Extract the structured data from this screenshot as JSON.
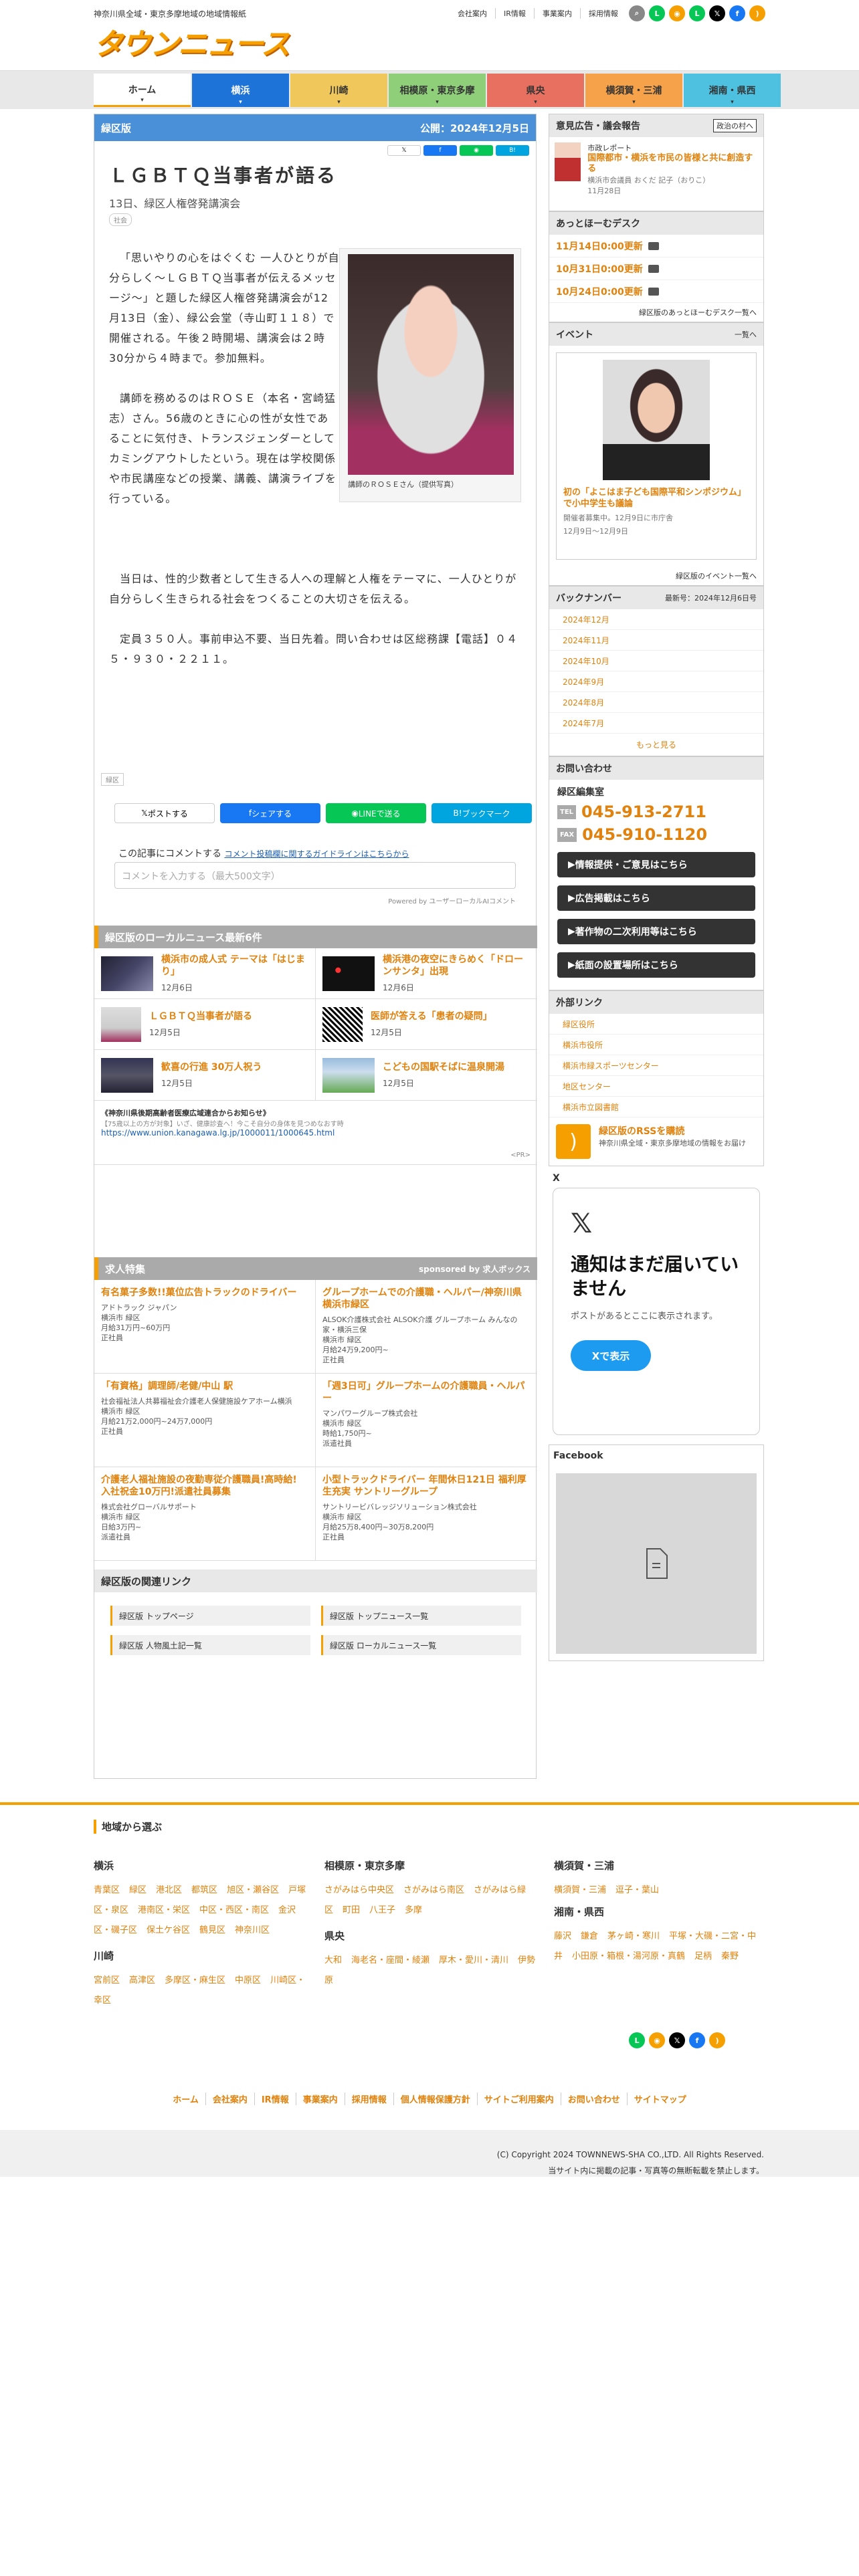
{
  "header": {
    "tagline": "神奈川県全域・東京多摩地域の地域情報紙",
    "logo": "タウンニュース",
    "toplinks": [
      "会社案内",
      "IR情報",
      "事業案内",
      "採用情報"
    ]
  },
  "nav": {
    "items": [
      {
        "label": "ホーム",
        "color": "#ffffff",
        "text": "#333333"
      },
      {
        "label": "横浜",
        "color": "#1e73d8",
        "text": "#ffffff"
      },
      {
        "label": "川崎",
        "color": "#f0c75a",
        "text": "#333333"
      },
      {
        "label": "相模原・東京多摩",
        "color": "#8fcf7a",
        "text": "#333333"
      },
      {
        "label": "県央",
        "color": "#e87060",
        "text": "#333333"
      },
      {
        "label": "横須賀・三浦",
        "color": "#f6a24a",
        "text": "#333333"
      },
      {
        "label": "湘南・県西",
        "color": "#4ec1e0",
        "text": "#333333"
      }
    ]
  },
  "article": {
    "edition": "緑区版",
    "published": "公開：2024年12月5日",
    "title": "ＬＧＢＴＱ当事者が語る",
    "subtitle": "13日、緑区人権啓発講演会",
    "tag": "社会",
    "p1": "「思いやりの心をはぐくむ 一人ひとりが自分らしく～ＬＧＢＴＱ当事者が伝えるメッセージ～」と題した緑区人権啓発講演会が12月13日（金）、緑公会堂（寺山町１１８）で開催される。午後２時開場、講演会は２時30分から４時まで。参加無料。",
    "p2": "講師を務めるのはＲＯＳＥ（本名・宮崎猛志）さん。56歳のときに心の性が女性であることに気付き、トランスジェンダーとしてカミングアウトしたという。現在は学校関係や市民講座などの授業、講義、講演ライブを行っている。",
    "p3": "当日は、性的少数者として生きる人への理解と人権をテーマに、一人ひとりが自分らしく生きられる社会をつくることの大切さを伝える。",
    "p4": "定員３５０人。事前申込不要、当日先着。問い合わせは区総務課【電話】０４５・９３０・２２１１。",
    "photo_caption": "講師のＲＯＳＥさん（提供写真）",
    "area_tag": "緑区",
    "share": {
      "x": "ポストする",
      "fb": "シェアする",
      "line": "LINEで送る",
      "hatena": "ブックマーク"
    },
    "comment_label": "この記事にコメントする",
    "comment_link": "コメント投稿欄に関するガイドラインはこちらから",
    "comment_placeholder": "コメントを入力する（最大500文字）",
    "powered": "Powered by ユーザーローカルAIコメント"
  },
  "local_news": {
    "heading": "緑区版のローカルニュース最新6件",
    "items": [
      {
        "title": "横浜市の成人式 テーマは「はじまり」",
        "date": "12月6日"
      },
      {
        "title": "横浜港の夜空にきらめく「ドローンサンタ」出現",
        "date": "12月6日"
      },
      {
        "title": "ＬＧＢＴＱ当事者が語る",
        "date": "12月5日"
      },
      {
        "title": "医師が答える「患者の疑問」",
        "date": "12月5日"
      },
      {
        "title": "歓喜の行進 30万人祝う",
        "date": "12月5日"
      },
      {
        "title": "こどもの国駅そばに温泉開湯",
        "date": "12月5日"
      }
    ],
    "pr_title": "《神奈川県後期高齢者医療広域連合からお知らせ》",
    "pr_sub": "【75歳以上の方が対象】いざ、健康診査へ！今こそ自分の身体を見つめなおす時",
    "pr_url": "https://www.union.kanagawa.lg.jp/1000011/1000645.html",
    "pr_badge": "<PR>"
  },
  "jobs": {
    "heading": "求人特集",
    "sponsor": "sponsored by 求人ボックス",
    "items": [
      {
        "title": "有名菓子多数!!菓位広告トラックのドライバー",
        "company": "アドトラック ジャパン",
        "area": "横浜市 緑区",
        "pay": "月給31万円~60万円",
        "type": "正社員"
      },
      {
        "title": "グループホームでの介護職・ヘルパー/神奈川県横浜市緑区",
        "company": "ALSOK介護株式会社 ALSOK介護 グループホーム みんなの家・横浜三保",
        "area": "横浜市 緑区",
        "pay": "月給24万9,200円~",
        "type": "正社員"
      },
      {
        "title": "「有資格」調理師/老健/中山 駅",
        "company": "社会福祉法人共募福祉会介護老人保健施設ケアホーム横浜",
        "area": "横浜市 緑区",
        "pay": "月給21万2,000円~24万7,000円",
        "type": "正社員"
      },
      {
        "title": "「週3日可」グループホームの介護職員・ヘルパー",
        "company": "マンパワーグループ株式会社",
        "area": "横浜市 緑区",
        "pay": "時給1,750円~",
        "type": "派遣社員"
      },
      {
        "title": "介護老人福祉施設の夜勤専従介護職員!高時給! 入社祝金10万円!派遣社員募集",
        "company": "株式会社グローバルサポート",
        "area": "横浜市 緑区",
        "pay": "日給3万円~",
        "type": "派遣社員"
      },
      {
        "title": "小型トラックドライバー 年間休日121日 福利厚生充実 サントリーグループ",
        "company": "サントリービバレッジソリューション株式会社",
        "area": "横浜市 緑区",
        "pay": "月給25万8,400円~30万8,200円",
        "type": "正社員"
      }
    ]
  },
  "related": {
    "heading": "緑区版の関連リンク",
    "items": [
      "緑区版 トップページ",
      "緑区版 トップニュース一覧",
      "緑区版 人物風土記一覧",
      "緑区版 ローカルニュース一覧"
    ]
  },
  "sidebar": {
    "opinion_head": "意見広告・議会報告",
    "opinion_badge": "政治の村へ",
    "opinion_cat": "市政レポート",
    "opinion_title": "国際都市・横浜を市民の皆様と共に創造する",
    "opinion_author": "横浜市会議員 おくだ 記子（おりこ）",
    "opinion_date": "11月28日",
    "desk_head": "あっとほーむデスク",
    "desk_items": [
      "11月14日0:00更新",
      "10月31日0:00更新",
      "10月24日0:00更新"
    ],
    "desk_more": "緑区版のあっとほーむデスク一覧へ",
    "event_head": "イベント",
    "event_more": "一覧へ",
    "event_title": "初の「よこはま子ども国際平和シンポジウム」で小中学生も議論",
    "event_org": "開催者募集中。12月9日に市庁舎",
    "event_date": "12月9日～12月9日",
    "event_list": "緑区版のイベント一覧へ",
    "back_head": "バックナンバー",
    "back_latest": "最新号：2024年12月6日号",
    "back_items": [
      "2024年12月",
      "2024年11月",
      "2024年10月",
      "2024年9月",
      "2024年8月",
      "2024年7月"
    ],
    "back_more": "もっと見る",
    "contact_head": "お問い合わせ",
    "contact_office": "緑区編集室",
    "tel_label": "TEL",
    "fax_label": "FAX",
    "tel": "045-913-2711",
    "fax": "045-910-1120",
    "contact_buttons": [
      "情報提供・ご意見はこちら",
      "広告掲載はこちら",
      "著作物の二次利用等はこちら",
      "紙面の設置場所はこちら"
    ],
    "ext_head": "外部リンク",
    "ext_items": [
      "緑区役所",
      "横浜市役所",
      "横浜市緑スポーツセンター",
      "地区センター",
      "横浜市立図書館"
    ],
    "rss_title": "緑区版のRSSを購読",
    "rss_desc": "神奈川県全域・東京多摩地域の情報をお届け",
    "x_head": "X",
    "x_title": "通知はまだ届いていません",
    "x_sub": "ポストがあるとここに表示されます。",
    "x_button": "Xで表示",
    "fb_head": "Facebook"
  },
  "footer": {
    "heading": "地域から選ぶ",
    "yokohama_head": "横浜",
    "yokohama_links": [
      "青葉区",
      "緑区",
      "港北区",
      "都筑区",
      "旭区・瀬谷区",
      "戸塚区・泉区",
      "港南区・栄区",
      "中区・西区・南区",
      "金沢区・磯子区",
      "保土ケ谷区",
      "鶴見区",
      "神奈川区"
    ],
    "kawasaki_head": "川崎",
    "kawasaki_links": [
      "宮前区",
      "高津区",
      "多摩区・麻生区",
      "中原区",
      "川崎区・幸区"
    ],
    "sagami_head": "相模原・東京多摩",
    "sagami_links": [
      "さがみはら中央区",
      "さがみはら南区",
      "さがみはら緑区",
      "町田",
      "八王子",
      "多摩"
    ],
    "kenou_head": "県央",
    "kenou_links": [
      "大和",
      "海老名・座間・綾瀬",
      "厚木・愛川・清川",
      "伊勢原"
    ],
    "yokosuka_head": "横須賀・三浦",
    "yokosuka_links": [
      "横須賀・三浦",
      "逗子・葉山"
    ],
    "shonan_head": "湘南・県西",
    "shonan_links": [
      "藤沢",
      "鎌倉",
      "茅ヶ崎・寒川",
      "平塚・大磯・二宮・中井",
      "小田原・箱根・湯河原・真鶴",
      "足柄",
      "秦野"
    ],
    "bottom_links": [
      "ホーム",
      "会社案内",
      "IR情報",
      "事業案内",
      "採用情報",
      "個人情報保護方針",
      "サイトご利用案内",
      "お問い合わせ",
      "サイトマップ"
    ],
    "copyright": "(C) Copyright 2024 TOWNNEWS-SHA CO.,LTD. All Rights Reserved.",
    "notice": "当サイト内に掲載の記事・写真等の無断転載を禁止します。"
  }
}
